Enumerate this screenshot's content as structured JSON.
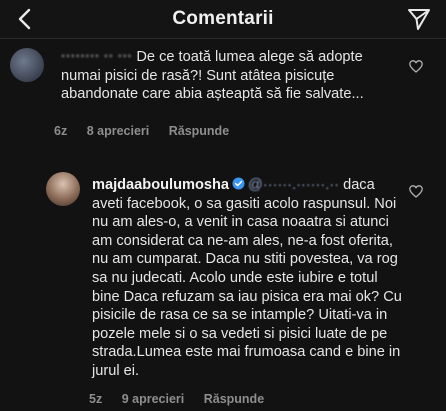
{
  "header": {
    "title": "Comentarii",
    "back_icon": "chevron-left-icon",
    "share_icon": "paper-plane-icon"
  },
  "comments": [
    {
      "username_obscured": "········ ·· ···",
      "text": "De ce toată lumea alege să adopte numai pisici de rasă?! Sunt atâtea pisicuțe abandonate care abia așteaptă să fie salvate...",
      "time": "6z",
      "likes": "8 aprecieri",
      "reply": "Răspunde"
    },
    {
      "username": "majdaaboulumosha",
      "mention_obscured": "@······.······.··",
      "text": "daca aveti facebook, o sa gasiti acolo raspunsul. Noi nu am ales-o, a venit in casa noaatra si atunci am considerat ca ne-am ales, ne-a fost oferita, nu am cumparat. Daca nu stiti povestea, va rog sa nu judecati. Acolo unde este iubire e totul bine Daca refuzam sa iau pisica era mai ok? Cu pisicile de rasa ce sa se intample? Uitati-va in pozele mele si o sa vedeti si pisici luate de pe strada.Lumea este mai frumoasa cand e bine in jurul ei.",
      "time": "5z",
      "likes": "9 aprecieri",
      "reply": "Răspunde"
    }
  ],
  "colors": {
    "background": "#121212",
    "text": "#e6e6e6",
    "meta": "#8e8e8e",
    "verified": "#3897f0"
  }
}
